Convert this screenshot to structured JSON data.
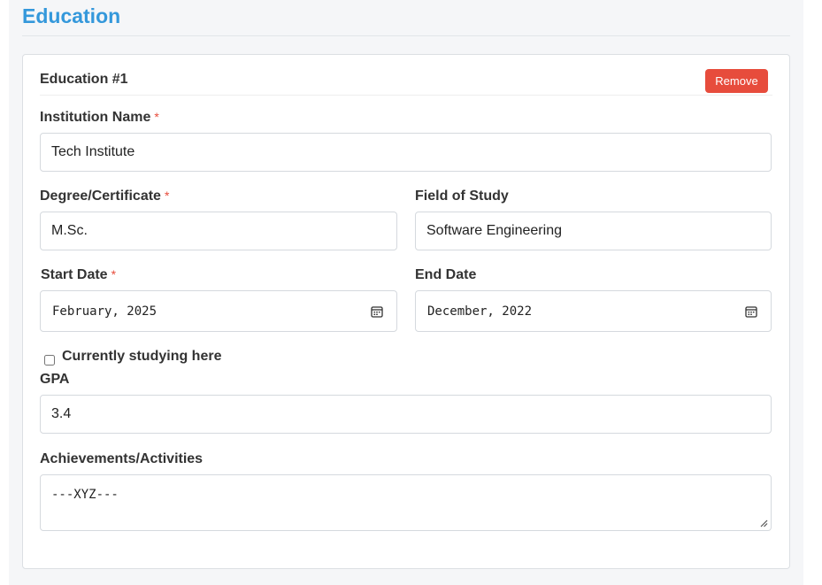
{
  "section": {
    "title": "Education"
  },
  "education": {
    "card_title": "Education #1",
    "remove_label": "Remove",
    "required_mark": "*",
    "institution": {
      "label": "Institution Name",
      "value": "Tech Institute"
    },
    "degree": {
      "label": "Degree/Certificate",
      "value": "M.Sc."
    },
    "field_of_study": {
      "label": "Field of Study",
      "value": "Software Engineering"
    },
    "start_date": {
      "label": "Start Date",
      "value": "February, 2025"
    },
    "end_date": {
      "label": "End Date",
      "value": "December, 2022"
    },
    "currently_studying": {
      "label": "Currently studying here",
      "checked": false
    },
    "gpa": {
      "label": "GPA",
      "value": "3.4"
    },
    "achievements": {
      "label": "Achievements/Activities",
      "value": "---XYZ---"
    }
  },
  "icons": {
    "date_picker": "calendar-icon",
    "resize": "resize-grip-icon"
  },
  "colors": {
    "accent": "#3498db",
    "danger": "#e74c3c",
    "required": "#e74c3c"
  }
}
